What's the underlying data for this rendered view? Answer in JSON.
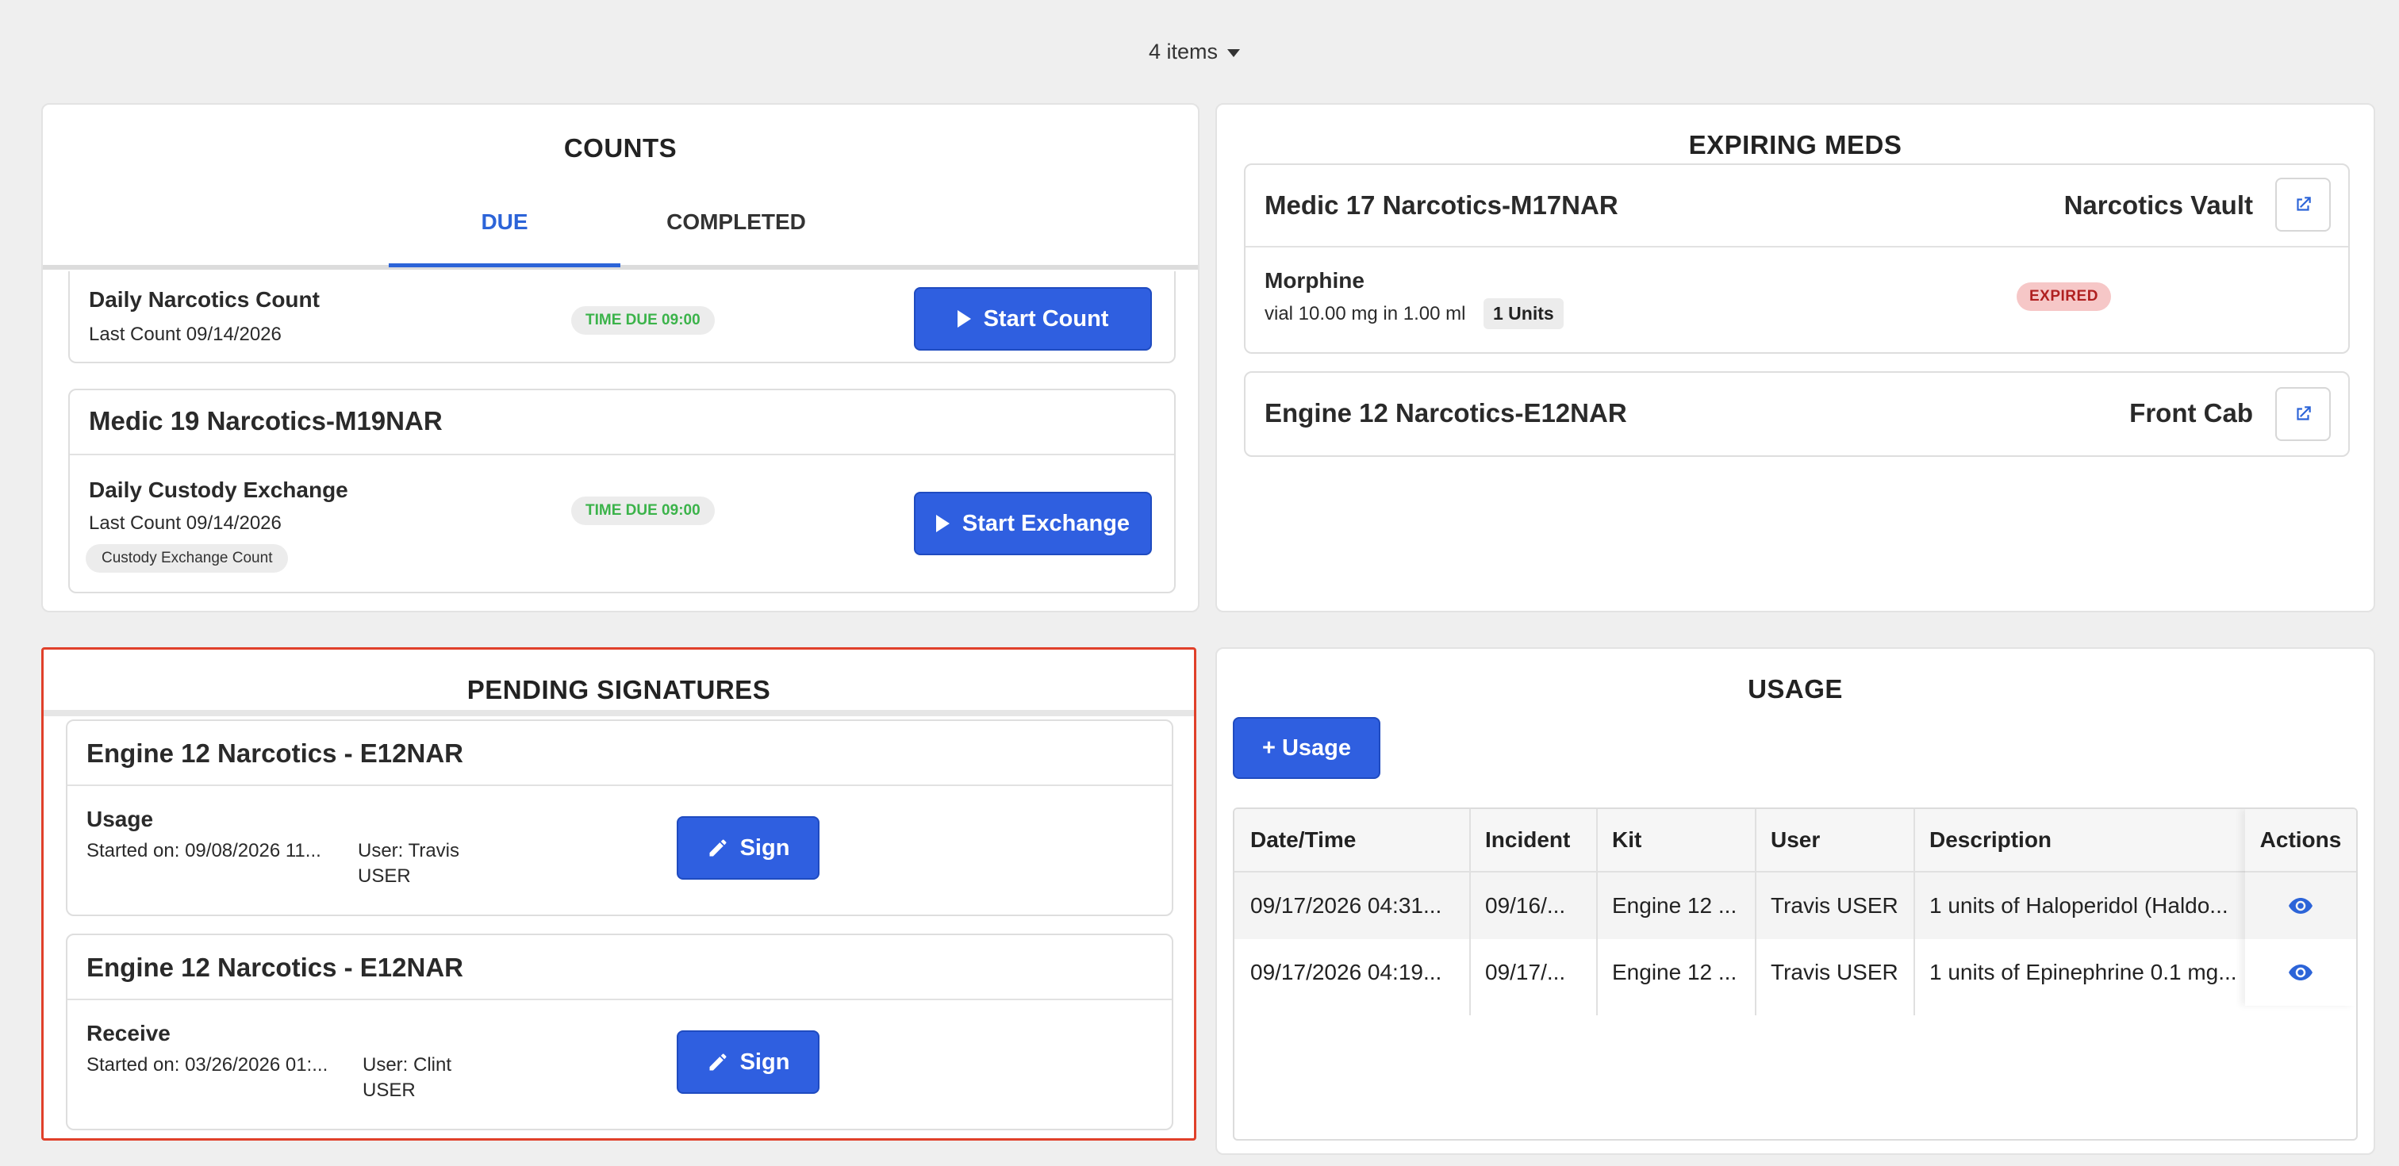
{
  "header": {
    "items_label": "4 items"
  },
  "counts": {
    "title": "COUNTS",
    "tabs": [
      "DUE",
      "COMPLETED"
    ],
    "rows": [
      {
        "title": "Daily Narcotics Count",
        "last_count": "Last Count  09/14/2026",
        "time_due": "TIME DUE  09:00",
        "button": "Start Count"
      },
      {
        "group": "Medic 19 Narcotics-M19NAR",
        "title": "Daily Custody Exchange",
        "last_count": "Last Count  09/14/2026",
        "chip": "Custody Exchange Count",
        "time_due": "TIME DUE  09:00",
        "button": "Start Exchange"
      }
    ]
  },
  "expiring": {
    "title": "EXPIRING MEDS",
    "kits": [
      {
        "name": "Medic 17 Narcotics-M17NAR",
        "location": "Narcotics Vault",
        "med": {
          "name": "Morphine",
          "detail": "vial 10.00 mg in 1.00 ml",
          "units": "1 Units",
          "status": "EXPIRED"
        }
      },
      {
        "name": "Engine 12 Narcotics-E12NAR",
        "location": "Front Cab"
      }
    ]
  },
  "pending": {
    "title": "PENDING SIGNATURES",
    "items": [
      {
        "kit": "Engine 12 Narcotics - E12NAR",
        "type": "Usage",
        "started": "Started on: 09/08/2026 11...",
        "user_line1": "User: Travis",
        "user_line2": "USER",
        "button": "Sign"
      },
      {
        "kit": "Engine 12 Narcotics - E12NAR",
        "type": "Receive",
        "started": "Started on: 03/26/2026 01:...",
        "user_line1": "User: Clint",
        "user_line2": "USER",
        "button": "Sign"
      }
    ]
  },
  "usage": {
    "title": "USAGE",
    "add_button": "+  Usage",
    "columns": [
      "Date/Time",
      "Incident",
      "Kit",
      "User",
      "Description",
      "Actions"
    ],
    "rows": [
      [
        "09/17/2026 04:31...",
        "09/16/...",
        "Engine 12 ...",
        "Travis USER",
        "1 units of Haloperidol (Haldo..."
      ],
      [
        "09/17/2026 04:19...",
        "09/17/...",
        "Engine 12 ...",
        "Travis USER",
        "1 units of Epinephrine 0.1 mg..."
      ]
    ]
  },
  "colors": {
    "primary": "#2f5fe0",
    "highlight_border": "#e0402a",
    "green": "#3bb34a",
    "expired": "#b02020"
  }
}
